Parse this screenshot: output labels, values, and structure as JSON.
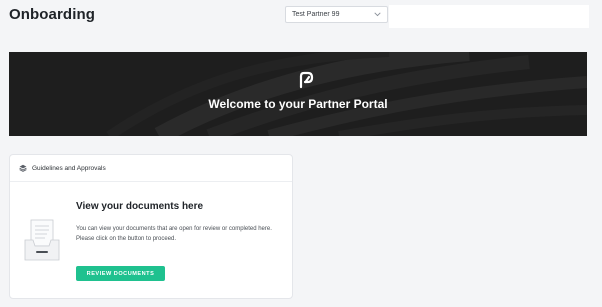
{
  "header": {
    "title": "Onboarding",
    "partner_select": {
      "value": "Test Partner 99",
      "icon": "chevron-down-icon"
    }
  },
  "banner": {
    "title": "Welcome to your Partner Portal",
    "logo_icon": "partner-portal-logo"
  },
  "guidelines_card": {
    "header_label": "Guidelines and Approvals",
    "header_icon": "layers-icon",
    "illustration": "document-tray-icon",
    "title": "View your documents here",
    "description": "You can view your documents that are open for review or completed here. Please click on the button to proceed.",
    "button_label": "REVIEW DOCUMENTS"
  },
  "colors": {
    "page_background": "#f4f5f7",
    "banner_background": "#1e1e1e",
    "primary_button": "#1fc18f"
  }
}
